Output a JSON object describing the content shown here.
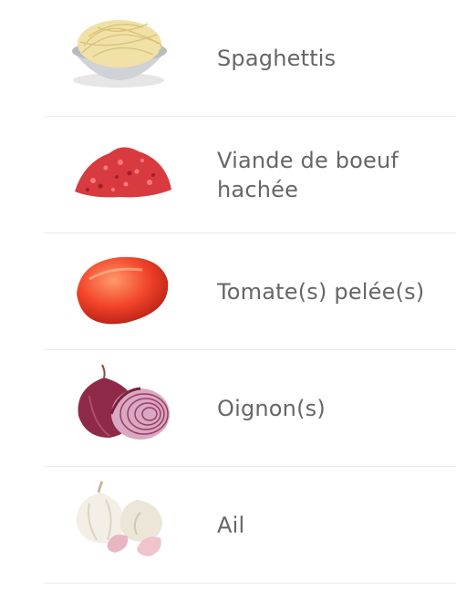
{
  "ingredients": [
    {
      "name": "Spaghettis",
      "icon": "spaghetti-icon"
    },
    {
      "name": "Viande de boeuf hachée",
      "icon": "ground-beef-icon"
    },
    {
      "name": "Tomate(s) pelée(s)",
      "icon": "tomato-icon"
    },
    {
      "name": "Oignon(s)",
      "icon": "onion-icon"
    },
    {
      "name": "Ail",
      "icon": "garlic-icon"
    }
  ]
}
